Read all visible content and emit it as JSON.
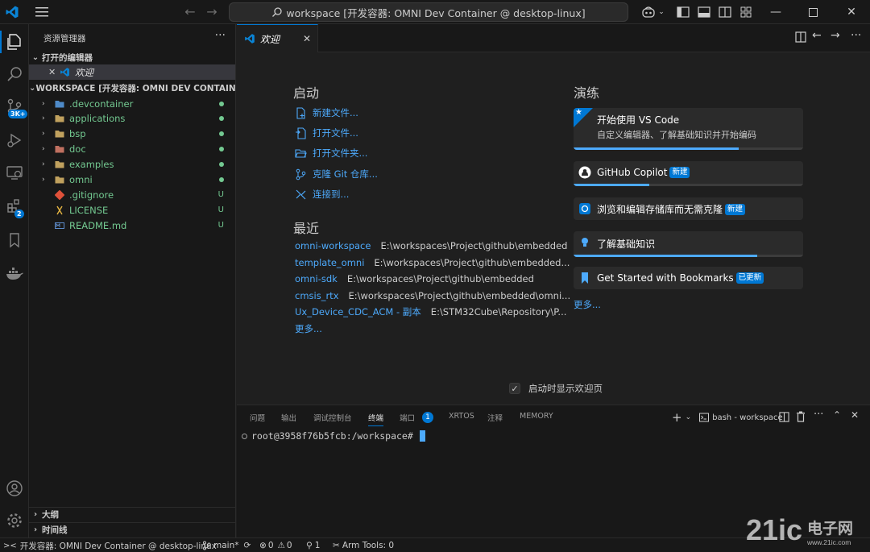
{
  "titlebar": {
    "command_center": "workspace [开发容器: OMNI Dev Container @ desktop-linux]"
  },
  "activity": {
    "scm_badge": "3K+",
    "extensions_badge": "2"
  },
  "sidebar": {
    "title": "资源管理器",
    "more": "···",
    "open_editors_header": "打开的编辑器",
    "open_editor_item": "欢迎",
    "workspace_header": "WORKSPACE [开发容器: OMNI DEV CONTAINER @ ...",
    "files": [
      {
        "name": ".devcontainer",
        "status": "dot",
        "color": "#73c991",
        "type": "folder"
      },
      {
        "name": "applications",
        "status": "dot",
        "color": "#73c991",
        "type": "folder"
      },
      {
        "name": "bsp",
        "status": "dot",
        "color": "#73c991",
        "type": "folder"
      },
      {
        "name": "doc",
        "status": "dot",
        "color": "#73c991",
        "type": "folder"
      },
      {
        "name": "examples",
        "status": "dot",
        "color": "#73c991",
        "type": "folder"
      },
      {
        "name": "omni",
        "status": "dot",
        "color": "#73c991",
        "type": "folder"
      },
      {
        "name": ".gitignore",
        "status": "U",
        "color": "#73c991",
        "type": "file"
      },
      {
        "name": "LICENSE",
        "status": "U",
        "color": "#73c991",
        "type": "file"
      },
      {
        "name": "README.md",
        "status": "U",
        "color": "#73c991",
        "type": "file"
      }
    ],
    "outline_header": "大纲",
    "timeline_header": "时间线"
  },
  "tab": {
    "label": "欢迎",
    "close": "✕"
  },
  "welcome": {
    "start_heading": "启动",
    "start_items": [
      "新建文件...",
      "打开文件...",
      "打开文件夹...",
      "克隆 Git 仓库...",
      "连接到..."
    ],
    "recent_heading": "最近",
    "recent": [
      {
        "name": "omni-workspace",
        "path": "E:\\workspaces\\Project\\github\\embedded"
      },
      {
        "name": "template_omni",
        "path": "E:\\workspaces\\Project\\github\\embedded..."
      },
      {
        "name": "omni-sdk",
        "path": "E:\\workspaces\\Project\\github\\embedded"
      },
      {
        "name": "cmsis_rtx",
        "path": "E:\\workspaces\\Project\\github\\embedded\\omni..."
      },
      {
        "name": "Ux_Device_CDC_ACM - 副本",
        "path": "E:\\STM32Cube\\Repository\\P..."
      }
    ],
    "recent_more": "更多...",
    "walk_heading": "演练",
    "walkthroughs": [
      {
        "title": "开始使用 VS Code",
        "desc": "自定义编辑器、了解基础知识并开始编码",
        "badge": "",
        "progress": 0.72
      },
      {
        "title": "GitHub Copilot",
        "desc": "",
        "badge": "新建",
        "progress": 0.33
      },
      {
        "title": "浏览和编辑存储库而无需克隆",
        "desc": "",
        "badge": "新建",
        "progress": 0
      },
      {
        "title": "了解基础知识",
        "desc": "",
        "badge": "",
        "progress": 0.8
      },
      {
        "title": "Get Started with Bookmarks",
        "desc": "",
        "badge": "已更新",
        "progress": 0
      }
    ],
    "walk_more": "更多...",
    "show_on_startup": "启动时显示欢迎页"
  },
  "panel": {
    "tabs": [
      "问题",
      "输出",
      "调试控制台",
      "终端",
      "端口",
      "XRTOS",
      "注释",
      "MEMORY"
    ],
    "active_tab": "终端",
    "ports_badge": "1",
    "terminal_name": "bash - workspace",
    "prompt": "root@3958f76b5fcb:/workspace#"
  },
  "statusbar": {
    "remote": "开发容器: OMNI Dev Container @ desktop-linux",
    "branch": "main*",
    "errors": "0",
    "warnings": "0",
    "ports": "1",
    "arm_tools": "Arm Tools: 0"
  },
  "watermark": {
    "logo_text": "21ic电子网",
    "url": "www.21ic.com"
  },
  "colors": {
    "accent": "#0078d4",
    "link": "#4daafc",
    "git_added": "#73c991"
  }
}
